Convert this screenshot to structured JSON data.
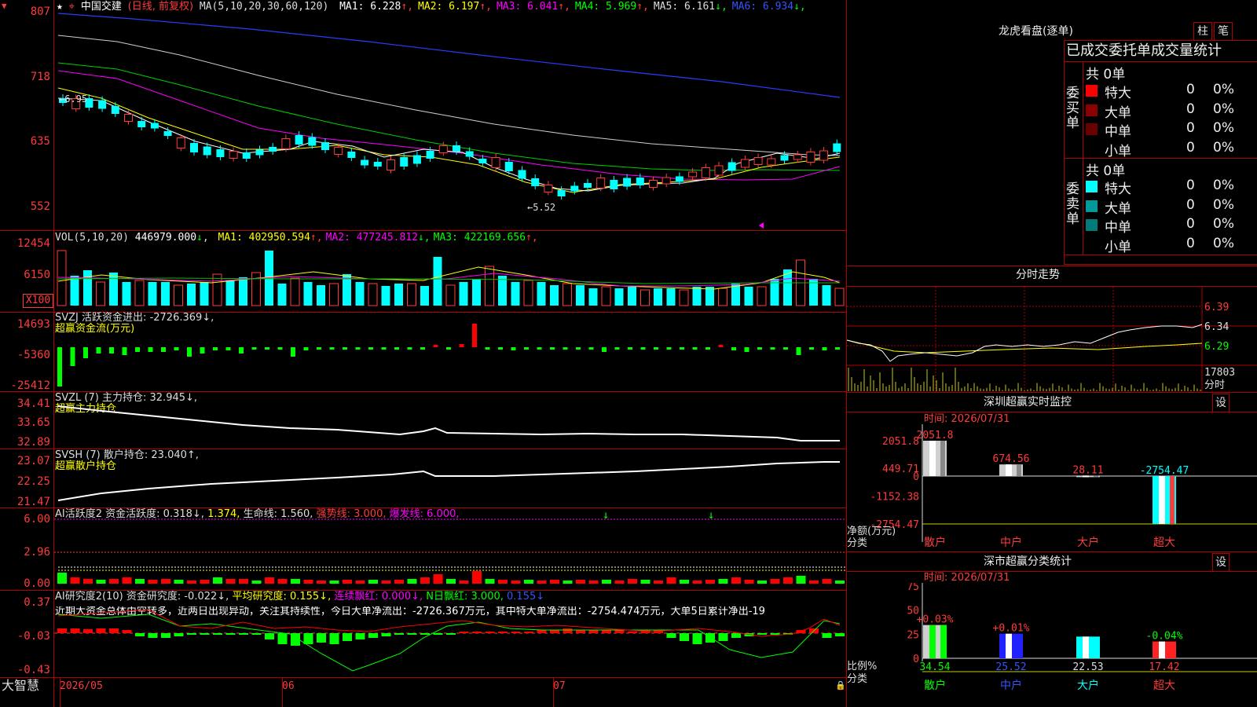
{
  "main": {
    "stock_name": "中国交建",
    "period_label": "(日线, 前复权)",
    "ma_params": "MA(5,10,20,30,60,120)",
    "ma_values": [
      {
        "label": "MA1:",
        "value": "6.228",
        "arrow": "↑",
        "color": "#ffffff",
        "arrow_color": "#ff3b3b"
      },
      {
        "label": "MA2:",
        "value": "6.197",
        "arrow": "↑",
        "color": "#ffff00",
        "arrow_color": "#ff3b3b"
      },
      {
        "label": "MA3:",
        "value": "6.041",
        "arrow": "↑",
        "color": "#ff00ff",
        "arrow_color": "#ff3b3b"
      },
      {
        "label": "MA4:",
        "value": "5.969",
        "arrow": "↑",
        "color": "#00ff00",
        "arrow_color": "#ff3b3b"
      },
      {
        "label": "MA5:",
        "value": "6.161",
        "arrow": "↓",
        "color": "#dddddd",
        "arrow_color": "#00ff00"
      },
      {
        "label": "MA6:",
        "value": "6.934",
        "arrow": "↓",
        "color": "#3355ff",
        "arrow_color": "#00ff00"
      }
    ],
    "y_ticks": [
      "807",
      "718",
      "635",
      "552"
    ],
    "max_marker": "6.95",
    "min_marker": "5.52"
  },
  "vol": {
    "header": "VOL(5,10,20)",
    "value": "446979.000",
    "value_arrow": "↓",
    "ma": [
      {
        "label": "MA1:",
        "value": "402950.594",
        "arrow": "↑",
        "color": "#ffff00",
        "arrow_color": "#ff3b3b"
      },
      {
        "label": "MA2:",
        "value": "477245.812",
        "arrow": "↓",
        "color": "#ff00ff",
        "arrow_color": "#00ff00"
      },
      {
        "label": "MA3:",
        "value": "422169.656",
        "arrow": "↑",
        "color": "#00ff00",
        "arrow_color": "#ff3b3b"
      }
    ],
    "y_ticks": [
      "12454",
      "6150"
    ],
    "unit": "X100"
  },
  "svzj": {
    "header": "SVZJ",
    "label": "活跃资金进出:",
    "value": "-2726.369↓,",
    "subtitle": "超赢资金流(万元)",
    "y_ticks": [
      "14693",
      "-5360",
      "-25412"
    ]
  },
  "svzl": {
    "header": "SVZL (7)",
    "label": "主力持仓:",
    "value": "32.945↓,",
    "subtitle": "超赢主力持仓",
    "y_ticks": [
      "34.41",
      "33.65",
      "32.89"
    ]
  },
  "svsh": {
    "header": "SVSH (7)",
    "label": "散户持仓:",
    "value": "23.040↑,",
    "subtitle": "超赢散户持仓",
    "y_ticks": [
      "23.07",
      "22.25",
      "21.47"
    ]
  },
  "ai1": {
    "header": "AI活跃度2",
    "l1": "资金活跃度:",
    "v1": "0.318↓,",
    "v2": "1.374,",
    "l3": "生命线:",
    "v3": "1.560,",
    "l4": "强势线:",
    "v4": "3.000,",
    "l5": "爆发线:",
    "v5": "6.000,",
    "y_ticks": [
      "6.00",
      "2.96",
      "0.00"
    ]
  },
  "ai2": {
    "header": "AI研究度2(10)",
    "l1": "资金研究度:",
    "v1": "-0.022↓,",
    "l2": "平均研究度:",
    "v2": "0.155↓,",
    "l3": "连续飘红:",
    "v3": "0.000↓,",
    "l4": "N日飘红:",
    "v4": "3.000,",
    "v5": "0.155↓",
    "comment": "近期大资金总体由空转多，近两日出现异动，关注其持续性，今日大单净流出：-2726.367万元，其中特大单净流出：-2754.474万元，大单5日累计净出-19",
    "y_ticks": [
      "0.37",
      "-0.03",
      "-0.43"
    ]
  },
  "bottom_axis": {
    "brand": "大智慧",
    "months": [
      "2026/05",
      "06",
      "07"
    ]
  },
  "dragon": {
    "title": "龙虎看盘(逐单)",
    "btn1": "柱",
    "btn2": "笔",
    "subtitle": "已成交委托单成交量统计",
    "buy_label": "委买单",
    "sell_label": "委卖单",
    "buy_total": "共 0单",
    "sell_total": "共 0单",
    "buy_rows": [
      {
        "name": "特大",
        "count": "0",
        "pct": "0%",
        "color": "#ff0000"
      },
      {
        "name": "大单",
        "count": "0",
        "pct": "0%",
        "color": "#8b0000"
      },
      {
        "name": "中单",
        "count": "0",
        "pct": "0%",
        "color": "#6b0000"
      },
      {
        "name": "小单",
        "count": "0",
        "pct": "0%",
        "color": ""
      }
    ],
    "sell_rows": [
      {
        "name": "特大",
        "count": "0",
        "pct": "0%",
        "color": "#00ffff"
      },
      {
        "name": "大单",
        "count": "0",
        "pct": "0%",
        "color": "#009a9a"
      },
      {
        "name": "中单",
        "count": "0",
        "pct": "0%",
        "color": "#007a7a"
      },
      {
        "name": "小单",
        "count": "0",
        "pct": "0%",
        "color": ""
      }
    ]
  },
  "intraday": {
    "title": "分时走势",
    "y_ticks": [
      "6.39",
      "6.34",
      "6.29"
    ],
    "vol_tick": "17803",
    "vol_unit": "分时"
  },
  "sz_monitor": {
    "title": "深圳超赢实时监控",
    "set_btn": "设",
    "time": "时间: 2026/07/31",
    "y_ticks": [
      "2051.8",
      "449.71",
      "0",
      "-1152.38",
      "-2754.47"
    ],
    "ylabel": "净额(万元)",
    "xlabel": "分类",
    "categories": [
      "散户",
      "中户",
      "大户",
      "超大"
    ],
    "bar_labels": [
      "2051.8",
      "674.56",
      "28.11",
      "-2754.47"
    ]
  },
  "sz_category": {
    "title": "深市超赢分类统计",
    "set_btn": "设",
    "time": "时间: 2026/07/31",
    "y_ticks": [
      "75",
      "50",
      "25",
      "0"
    ],
    "ylabel": "比例%",
    "xlabel": "分类",
    "categories": [
      "散户",
      "中户",
      "大户",
      "超大"
    ],
    "values": [
      "34.54",
      "25.52",
      "22.53",
      "17.42"
    ],
    "changes": [
      "+0.03%",
      "+0.01%",
      "",
      "-0.04%"
    ]
  },
  "chart_data": [
    {
      "type": "bar",
      "title": "深圳超赢实时监控",
      "ylabel": "净额(万元)",
      "xlabel": "分类",
      "categories": [
        "散户",
        "中户",
        "大户",
        "超大"
      ],
      "values": [
        2051.8,
        674.56,
        28.11,
        -2754.47
      ],
      "ylim": [
        -2754.47,
        2051.8
      ]
    },
    {
      "type": "bar",
      "title": "深市超赢分类统计",
      "ylabel": "比例%",
      "xlabel": "分类",
      "categories": [
        "散户",
        "中户",
        "大户",
        "超大"
      ],
      "values": [
        34.54,
        25.52,
        22.53,
        17.42
      ],
      "ylim": [
        0,
        75
      ]
    },
    {
      "type": "line",
      "title": "中国交建 (日线, 前复权)",
      "y_ticks": [
        807,
        718,
        635,
        552
      ],
      "series": [
        {
          "name": "MA1",
          "values": [
            6.228
          ]
        },
        {
          "name": "MA2",
          "values": [
            6.197
          ]
        },
        {
          "name": "MA3",
          "values": [
            6.041
          ]
        },
        {
          "name": "MA4",
          "values": [
            5.969
          ]
        },
        {
          "name": "MA5",
          "values": [
            6.161
          ]
        },
        {
          "name": "MA6",
          "values": [
            6.934
          ]
        }
      ]
    }
  ]
}
